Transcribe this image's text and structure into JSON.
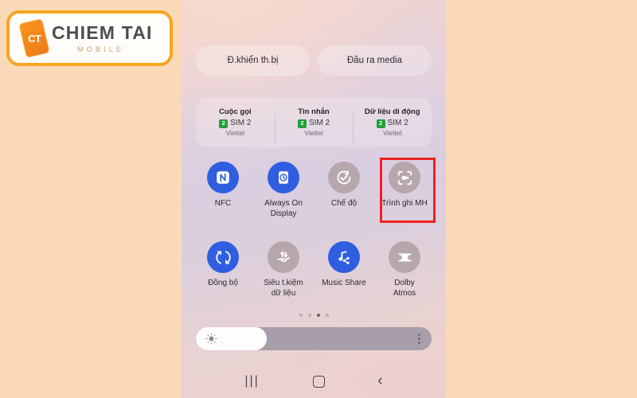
{
  "watermark": {
    "phone_badge": "CT",
    "brand": "CHIEM TAI",
    "tagline": "MOBILE",
    "accent_color": "#f5a623",
    "phone_color": "#f7941d"
  },
  "phone": {
    "media_pills": [
      {
        "label": "Đ.khiển th.bị",
        "name": "device-control-pill"
      },
      {
        "label": "Đầu ra media",
        "name": "media-output-pill"
      }
    ],
    "sim_panel": [
      {
        "title": "Cuộc gọi",
        "badge": "2",
        "sim": "SIM 2",
        "carrier": "Viettel"
      },
      {
        "title": "Tin nhắn",
        "badge": "2",
        "sim": "SIM 2",
        "carrier": "Viettel"
      },
      {
        "title": "Dữ liệu di động",
        "badge": "2",
        "sim": "SIM 2",
        "carrier": "Viettel"
      }
    ],
    "toggles_row1": [
      {
        "label": "NFC",
        "icon": "nfc-icon",
        "state": "on"
      },
      {
        "label": "Always On\nDisplay",
        "icon": "always-on-display-icon",
        "state": "on"
      },
      {
        "label": "Chế độ",
        "icon": "mode-check-icon",
        "state": "off"
      },
      {
        "label": "Trình ghi MH",
        "icon": "screen-recorder-icon",
        "state": "off"
      }
    ],
    "toggles_row2": [
      {
        "label": "Đồng bộ",
        "icon": "sync-icon",
        "state": "on"
      },
      {
        "label": "Siêu t.kiệm\ndữ liệu",
        "icon": "data-saver-icon",
        "state": "off"
      },
      {
        "label": "Music Share",
        "icon": "music-share-icon",
        "state": "on"
      },
      {
        "label": "Dolby\nAtmos",
        "icon": "dolby-atmos-icon",
        "state": "off"
      }
    ],
    "pagination": {
      "total": 4,
      "active_index": 3
    },
    "brightness": {
      "value_percent": 30,
      "icon": "brightness-sun-icon",
      "menu": "more-options-icon"
    },
    "navbar": {
      "recents": "|||",
      "home": "home-square-icon",
      "back": "‹"
    },
    "highlight": {
      "target": "Trình ghi MH",
      "color": "#ee2222"
    }
  }
}
